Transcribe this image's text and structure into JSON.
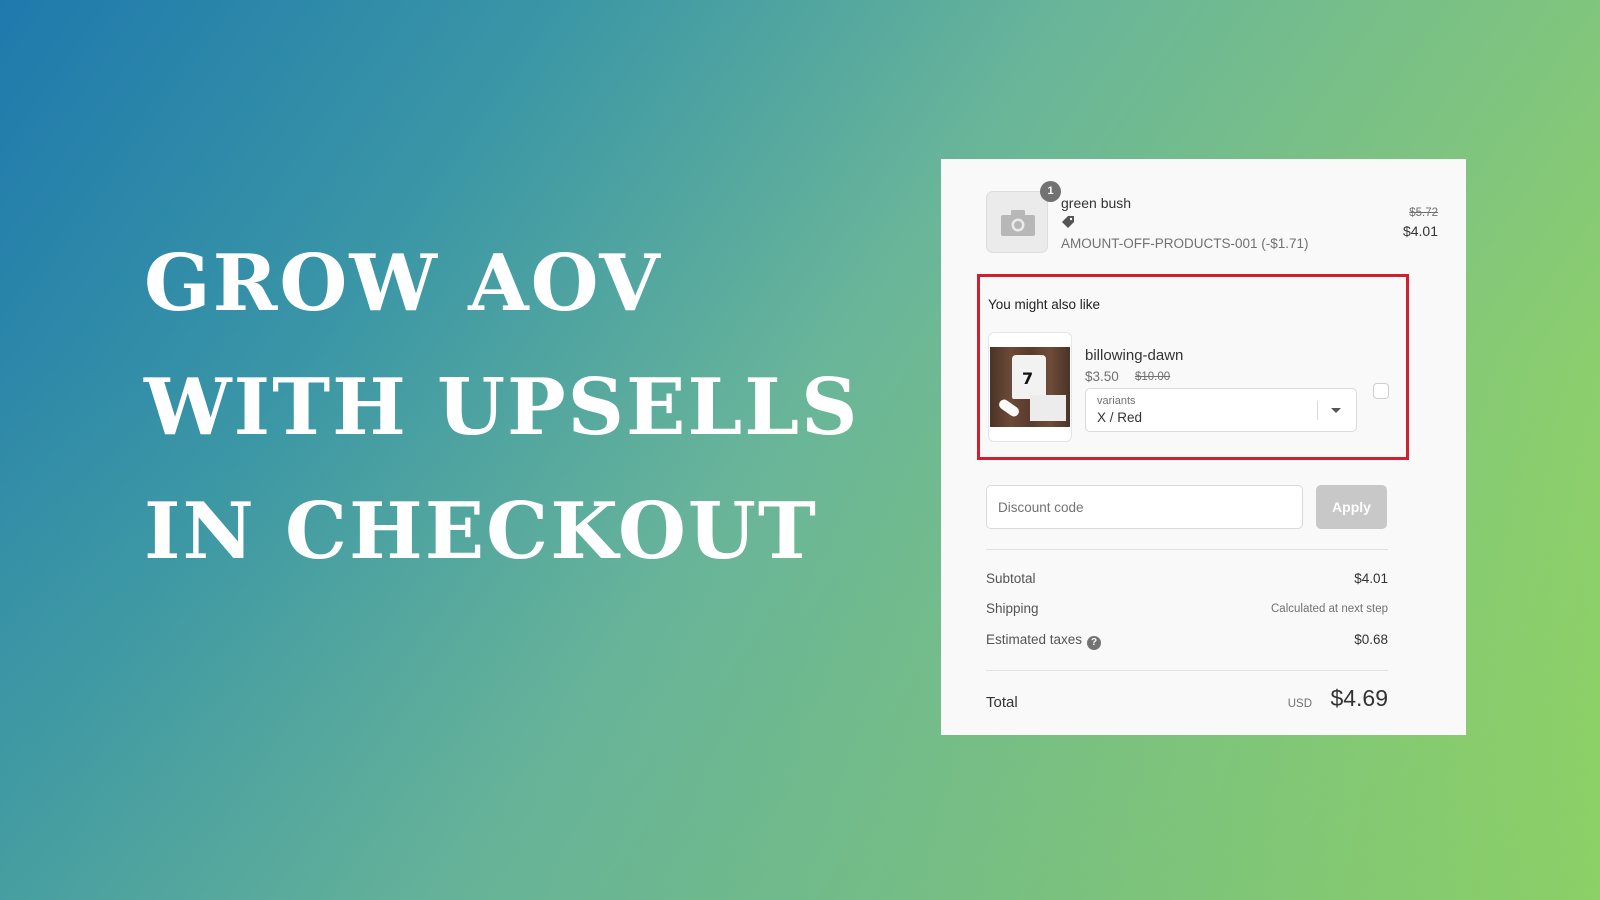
{
  "headline": {
    "lines": [
      "GROW AOV",
      "WITH UPSELLS",
      "IN CHECKOUT"
    ]
  },
  "colors": {
    "gradient_start": "#1f79ad",
    "gradient_end": "#9cdc57",
    "highlight_border": "#d0202f",
    "panel_bg": "#f9f9f9",
    "apply_button_bg": "#c8c8c8"
  },
  "cart": {
    "item": {
      "quantity": "1",
      "name": "green bush",
      "icon": "camera-icon",
      "discount_icon": "tag-icon",
      "discount_code": "AMOUNT-OFF-PRODUCTS-001 (-$1.71)",
      "original_price": "$5.72",
      "price": "$4.01"
    }
  },
  "upsell": {
    "title": "You might also like",
    "product": {
      "name": "billowing-dawn",
      "price": "$3.50",
      "compare_price": "$10.00",
      "variant_label": "variants",
      "variant_value": "X / Red",
      "checked": false
    }
  },
  "discount": {
    "placeholder": "Discount code",
    "apply_label": "Apply"
  },
  "summary": {
    "subtotal_label": "Subtotal",
    "subtotal_value": "$4.01",
    "shipping_label": "Shipping",
    "shipping_value": "Calculated at next step",
    "taxes_label": "Estimated taxes",
    "taxes_help": "?",
    "taxes_value": "$0.68",
    "total_label": "Total",
    "total_currency": "USD",
    "total_value": "$4.69"
  }
}
